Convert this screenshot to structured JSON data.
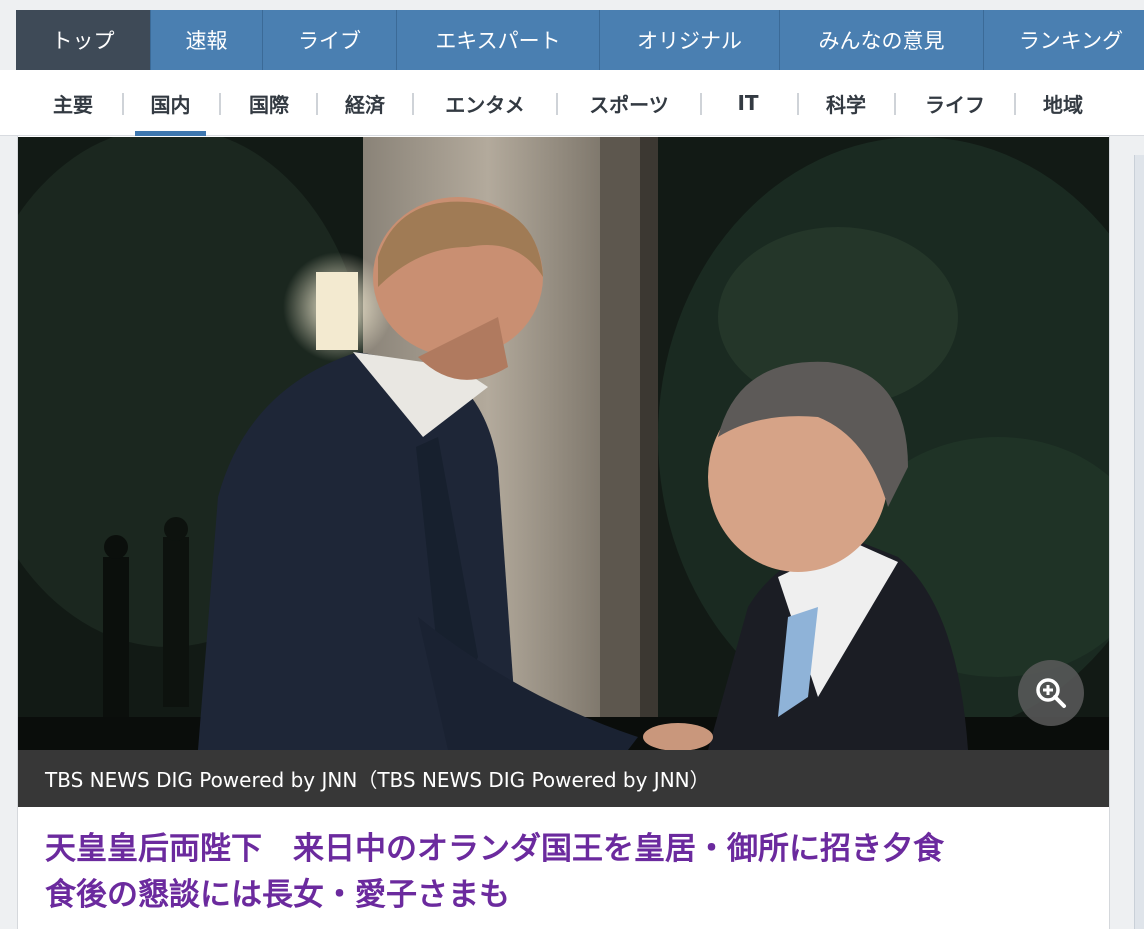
{
  "top_nav": {
    "tabs": [
      {
        "label": "トップ",
        "active": true
      },
      {
        "label": "速報",
        "active": false
      },
      {
        "label": "ライブ",
        "active": false
      },
      {
        "label": "エキスパート",
        "active": false
      },
      {
        "label": "オリジナル",
        "active": false
      },
      {
        "label": "みんなの意見",
        "active": false
      },
      {
        "label": "ランキング",
        "active": false
      }
    ]
  },
  "sub_nav": {
    "items": [
      {
        "label": "主要",
        "active": false
      },
      {
        "label": "国内",
        "active": true
      },
      {
        "label": "国際",
        "active": false
      },
      {
        "label": "経済",
        "active": false
      },
      {
        "label": "エンタメ",
        "active": false
      },
      {
        "label": "スポーツ",
        "active": false
      },
      {
        "label": "IT",
        "active": false
      },
      {
        "label": "科学",
        "active": false
      },
      {
        "label": "ライフ",
        "active": false
      },
      {
        "label": "地域",
        "active": false
      }
    ]
  },
  "article": {
    "photo_icon": "zoom-in-icon",
    "caption": "TBS NEWS DIG Powered by JNN（TBS NEWS DIG Powered by JNN）",
    "headline_line1": "天皇皇后両陛下　来日中のオランダ国王を皇居・御所に招き夕食",
    "headline_line2": "食後の懇談には長女・愛子さまも"
  },
  "colors": {
    "nav_blue": "#4a7fb1",
    "nav_active": "#3e4a57",
    "subnav_underline": "#3f78b0",
    "headline_purple": "#6b2a9e",
    "caption_bg": "#373737"
  }
}
